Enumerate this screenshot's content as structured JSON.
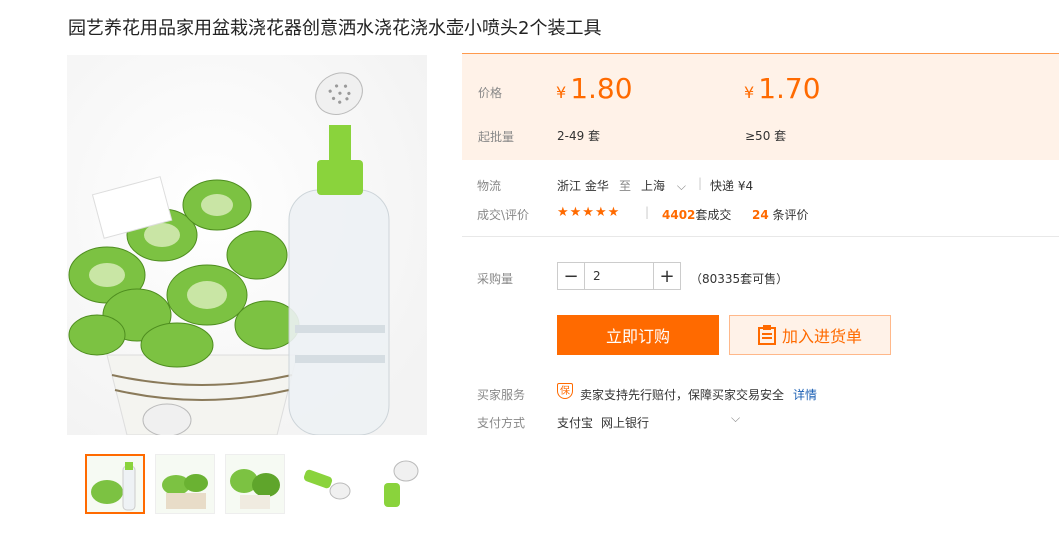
{
  "product": {
    "title": "园艺养花用品家用盆栽浇花器创意洒水浇花浇水壶小喷头2个装工具"
  },
  "price": {
    "label": "价格",
    "currency": "¥",
    "tiers": [
      {
        "price": "1.80",
        "qty": "2-49 套"
      },
      {
        "price": "1.70",
        "qty": "≥50 套"
      }
    ],
    "moq_label": "起批量"
  },
  "logistics": {
    "label": "物流",
    "from": "浙江 金华",
    "to_word": "至",
    "to": "上海",
    "express": "快递 ¥4"
  },
  "deals": {
    "label": "成交\\评价",
    "stars": "★★★★★",
    "count": "4402",
    "count_suffix": "套成交",
    "reviews": "24",
    "reviews_suffix": "条评价"
  },
  "quantity": {
    "label": "采购量",
    "minus": "−",
    "value": "2",
    "plus": "+",
    "stock": "（80335套可售）"
  },
  "actions": {
    "buy": "立即订购",
    "cart": "加入进货单"
  },
  "service": {
    "label": "买家服务",
    "badge": "保",
    "text": "卖家支持先行赔付，保障买家交易安全",
    "link": "详情"
  },
  "payment": {
    "label": "支付方式",
    "methods": [
      "支付宝",
      "网上银行"
    ]
  },
  "colors": {
    "accent": "#ff6a00",
    "price_bg": "#fff2e8"
  }
}
